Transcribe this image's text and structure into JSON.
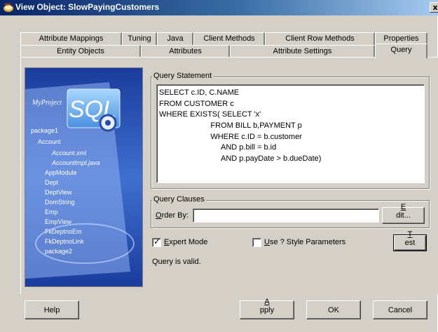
{
  "window": {
    "title": "View Object: SlowPayingCustomers",
    "close_glyph": "x"
  },
  "tabs_row1": [
    "Attribute Mappings",
    "Tuning",
    "Java",
    "Client Methods",
    "Client Row Methods",
    "Properties"
  ],
  "tabs_row2": [
    "Entity Objects",
    "Attributes",
    "Attribute Settings",
    "Query"
  ],
  "selected_tab": "Query",
  "side_image": {
    "project_label": "MyProject",
    "sql_label": "SQL",
    "tree": [
      "package1",
      "Account",
      "Account.xml",
      "AccountImpl.java",
      "AppModule",
      "Dept",
      "DeptView",
      "DomString",
      "Emp",
      "EmpView",
      "FkDeptnoEm",
      "FkDeptnoLink",
      "package2"
    ]
  },
  "query_statement": {
    "label": "Query Statement",
    "lines": [
      "SELECT c.ID, C.NAME",
      "FROM CUSTOMER c",
      "WHERE EXISTS( SELECT 'x'",
      "                        FROM BILL b,PAYMENT p",
      "                        WHERE c.ID = b.customer",
      "                             AND p.bill = b.id",
      "                             AND p.payDate > b.dueDate)"
    ]
  },
  "query_clauses": {
    "label": "Query Clauses",
    "order_by_label_u": "O",
    "order_by_label_rest": "rder By:",
    "order_by_value": "",
    "edit_button_u": "E",
    "edit_button_rest": "dit..."
  },
  "expert_mode": {
    "label_u": "E",
    "label_rest": "xpert Mode",
    "checked": true
  },
  "use_style_params": {
    "label_u": "U",
    "label_rest": "se ? Style Parameters",
    "checked": false
  },
  "test_button": {
    "label_u": "T",
    "label_rest": "est"
  },
  "status_text": "Query is valid.",
  "buttons": {
    "help": "Help",
    "apply_u": "A",
    "apply_rest": "pply",
    "ok": "OK",
    "cancel": "Cancel"
  },
  "colors": {
    "dialog_bg": "#d4d0c8",
    "title_start": "#0a246a",
    "title_end": "#a6caf0",
    "image_blue": "#2a4aa8"
  }
}
